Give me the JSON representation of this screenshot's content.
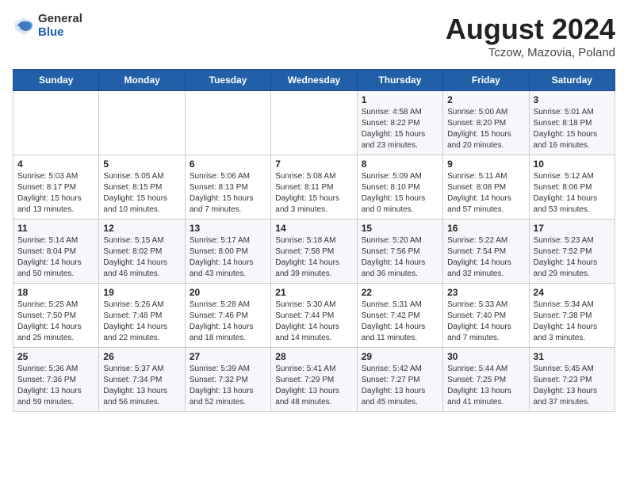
{
  "header": {
    "logo_general": "General",
    "logo_blue": "Blue",
    "month_year": "August 2024",
    "location": "Tczow, Mazovia, Poland"
  },
  "weekdays": [
    "Sunday",
    "Monday",
    "Tuesday",
    "Wednesday",
    "Thursday",
    "Friday",
    "Saturday"
  ],
  "weeks": [
    [
      {
        "day": "",
        "content": ""
      },
      {
        "day": "",
        "content": ""
      },
      {
        "day": "",
        "content": ""
      },
      {
        "day": "",
        "content": ""
      },
      {
        "day": "1",
        "content": "Sunrise: 4:58 AM\nSunset: 8:22 PM\nDaylight: 15 hours\nand 23 minutes."
      },
      {
        "day": "2",
        "content": "Sunrise: 5:00 AM\nSunset: 8:20 PM\nDaylight: 15 hours\nand 20 minutes."
      },
      {
        "day": "3",
        "content": "Sunrise: 5:01 AM\nSunset: 8:18 PM\nDaylight: 15 hours\nand 16 minutes."
      }
    ],
    [
      {
        "day": "4",
        "content": "Sunrise: 5:03 AM\nSunset: 8:17 PM\nDaylight: 15 hours\nand 13 minutes."
      },
      {
        "day": "5",
        "content": "Sunrise: 5:05 AM\nSunset: 8:15 PM\nDaylight: 15 hours\nand 10 minutes."
      },
      {
        "day": "6",
        "content": "Sunrise: 5:06 AM\nSunset: 8:13 PM\nDaylight: 15 hours\nand 7 minutes."
      },
      {
        "day": "7",
        "content": "Sunrise: 5:08 AM\nSunset: 8:11 PM\nDaylight: 15 hours\nand 3 minutes."
      },
      {
        "day": "8",
        "content": "Sunrise: 5:09 AM\nSunset: 8:10 PM\nDaylight: 15 hours\nand 0 minutes."
      },
      {
        "day": "9",
        "content": "Sunrise: 5:11 AM\nSunset: 8:08 PM\nDaylight: 14 hours\nand 57 minutes."
      },
      {
        "day": "10",
        "content": "Sunrise: 5:12 AM\nSunset: 8:06 PM\nDaylight: 14 hours\nand 53 minutes."
      }
    ],
    [
      {
        "day": "11",
        "content": "Sunrise: 5:14 AM\nSunset: 8:04 PM\nDaylight: 14 hours\nand 50 minutes."
      },
      {
        "day": "12",
        "content": "Sunrise: 5:15 AM\nSunset: 8:02 PM\nDaylight: 14 hours\nand 46 minutes."
      },
      {
        "day": "13",
        "content": "Sunrise: 5:17 AM\nSunset: 8:00 PM\nDaylight: 14 hours\nand 43 minutes."
      },
      {
        "day": "14",
        "content": "Sunrise: 5:18 AM\nSunset: 7:58 PM\nDaylight: 14 hours\nand 39 minutes."
      },
      {
        "day": "15",
        "content": "Sunrise: 5:20 AM\nSunset: 7:56 PM\nDaylight: 14 hours\nand 36 minutes."
      },
      {
        "day": "16",
        "content": "Sunrise: 5:22 AM\nSunset: 7:54 PM\nDaylight: 14 hours\nand 32 minutes."
      },
      {
        "day": "17",
        "content": "Sunrise: 5:23 AM\nSunset: 7:52 PM\nDaylight: 14 hours\nand 29 minutes."
      }
    ],
    [
      {
        "day": "18",
        "content": "Sunrise: 5:25 AM\nSunset: 7:50 PM\nDaylight: 14 hours\nand 25 minutes."
      },
      {
        "day": "19",
        "content": "Sunrise: 5:26 AM\nSunset: 7:48 PM\nDaylight: 14 hours\nand 22 minutes."
      },
      {
        "day": "20",
        "content": "Sunrise: 5:28 AM\nSunset: 7:46 PM\nDaylight: 14 hours\nand 18 minutes."
      },
      {
        "day": "21",
        "content": "Sunrise: 5:30 AM\nSunset: 7:44 PM\nDaylight: 14 hours\nand 14 minutes."
      },
      {
        "day": "22",
        "content": "Sunrise: 5:31 AM\nSunset: 7:42 PM\nDaylight: 14 hours\nand 11 minutes."
      },
      {
        "day": "23",
        "content": "Sunrise: 5:33 AM\nSunset: 7:40 PM\nDaylight: 14 hours\nand 7 minutes."
      },
      {
        "day": "24",
        "content": "Sunrise: 5:34 AM\nSunset: 7:38 PM\nDaylight: 14 hours\nand 3 minutes."
      }
    ],
    [
      {
        "day": "25",
        "content": "Sunrise: 5:36 AM\nSunset: 7:36 PM\nDaylight: 13 hours\nand 59 minutes."
      },
      {
        "day": "26",
        "content": "Sunrise: 5:37 AM\nSunset: 7:34 PM\nDaylight: 13 hours\nand 56 minutes."
      },
      {
        "day": "27",
        "content": "Sunrise: 5:39 AM\nSunset: 7:32 PM\nDaylight: 13 hours\nand 52 minutes."
      },
      {
        "day": "28",
        "content": "Sunrise: 5:41 AM\nSunset: 7:29 PM\nDaylight: 13 hours\nand 48 minutes."
      },
      {
        "day": "29",
        "content": "Sunrise: 5:42 AM\nSunset: 7:27 PM\nDaylight: 13 hours\nand 45 minutes."
      },
      {
        "day": "30",
        "content": "Sunrise: 5:44 AM\nSunset: 7:25 PM\nDaylight: 13 hours\nand 41 minutes."
      },
      {
        "day": "31",
        "content": "Sunrise: 5:45 AM\nSunset: 7:23 PM\nDaylight: 13 hours\nand 37 minutes."
      }
    ]
  ]
}
